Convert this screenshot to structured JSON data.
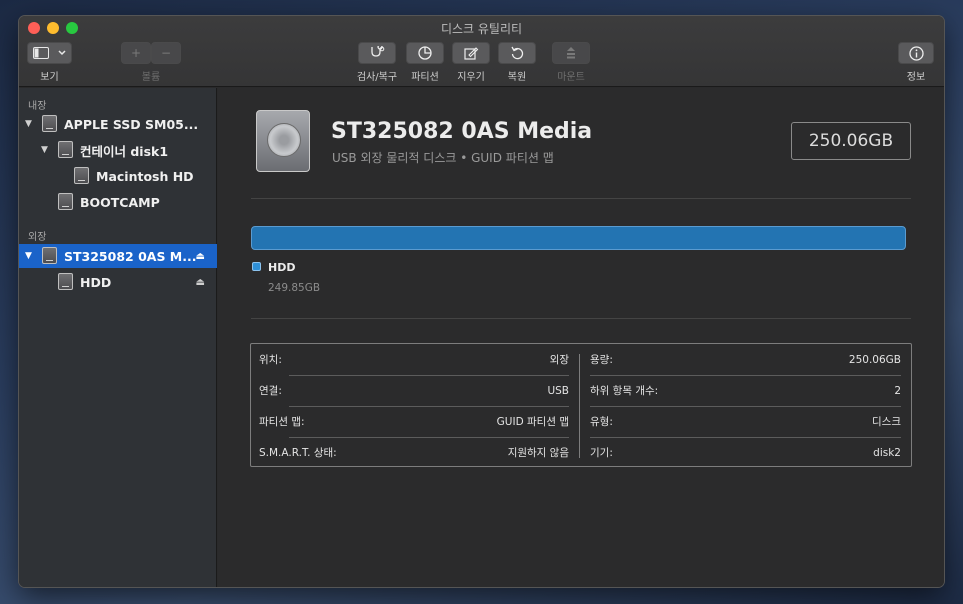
{
  "window": {
    "title": "디스크 유틸리티"
  },
  "toolbar": {
    "view_label": "보기",
    "volume_label": "볼륨",
    "add_symbol": "+",
    "remove_symbol": "−",
    "first_aid_label": "검사/복구",
    "partition_label": "파티션",
    "erase_label": "지우기",
    "restore_label": "복원",
    "mount_label": "마운트",
    "info_label": "정보",
    "icons": [
      "sidebar-icon",
      "stethoscope-icon",
      "pie-icon",
      "erase-icon",
      "restore-icon",
      "mount-icon",
      "info-icon"
    ]
  },
  "sidebar": {
    "internal_section": "내장",
    "external_section": "외장",
    "items": [
      {
        "label": "APPLE SSD SM05..."
      },
      {
        "label": "컨테이너 disk1"
      },
      {
        "label": "Macintosh HD"
      },
      {
        "label": "BOOTCAMP"
      },
      {
        "label": "ST325082 0AS M..."
      },
      {
        "label": "HDD"
      }
    ],
    "eject_symbol": "⏏",
    "disclosure_symbol": "▼"
  },
  "disk": {
    "name": "ST325082 0AS Media",
    "subtitle": "USB 외장 물리적 디스크 • GUID 파티션 맵",
    "capacity": "250.06GB",
    "partition": {
      "name": "HDD",
      "size": "249.85GB",
      "fraction": 1.0,
      "color": "#2374b2"
    }
  },
  "info": {
    "left": [
      {
        "key": "위치:",
        "value": "외장"
      },
      {
        "key": "연결:",
        "value": "USB"
      },
      {
        "key": "파티션 맵:",
        "value": "GUID 파티션 맵"
      },
      {
        "key": "S.M.A.R.T. 상태:",
        "value": "지원하지 않음"
      }
    ],
    "right": [
      {
        "key": "용량:",
        "value": "250.06GB"
      },
      {
        "key": "하위 항목 개수:",
        "value": "2"
      },
      {
        "key": "유형:",
        "value": "디스크"
      },
      {
        "key": "기기:",
        "value": "disk2"
      }
    ]
  },
  "colors": {
    "selection": "#1a63c9",
    "accent": "#2374b2"
  }
}
